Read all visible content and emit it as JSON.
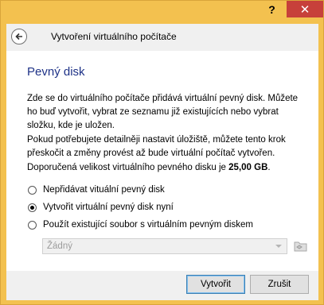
{
  "titlebar": {
    "help_label": "?",
    "close_label": "✕"
  },
  "header": {
    "title": "Vytvoření virtuálního počítače"
  },
  "content": {
    "section_title": "Pevný disk",
    "paragraph1": "Zde se do virtuálního počítače přidává virtuální pevný disk. Můžete ho buď vytvořit, vybrat ze seznamu již existujících nebo vybrat složku, kde je uložen.",
    "paragraph2": "Pokud potřebujete detailněji nastavit úložiště, můžete tento krok přeskočit a změny provést až bude virtuální počítač vytvořen.",
    "recommended_prefix": "Doporučená velikost virtuálního pevného disku je ",
    "recommended_value": "25,00 GB",
    "recommended_suffix": ".",
    "options": [
      {
        "label": "Nepřidávat vituální pevný disk",
        "checked": false
      },
      {
        "label": "Vytvořit virtuální pevný disk nyní",
        "checked": true
      },
      {
        "label": "Použít existující soubor s virtuálním pevným diskem",
        "checked": false
      }
    ],
    "existing_disk_select": {
      "value": "Žádný",
      "disabled": true
    }
  },
  "footer": {
    "create_label": "Vytvořit",
    "cancel_label": "Zrušit"
  }
}
